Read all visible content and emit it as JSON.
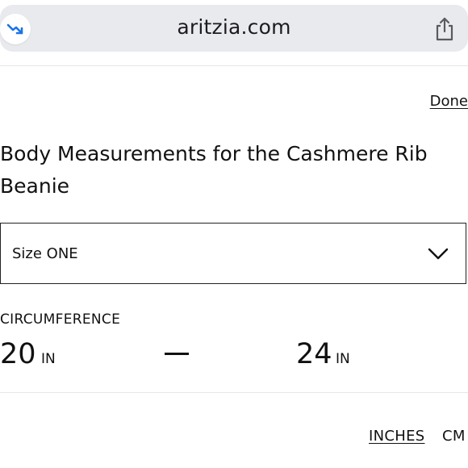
{
  "browser": {
    "url": "aritzia.com"
  },
  "sheet": {
    "done_label": "Done",
    "title": "Body Measurements for the Cashmere Rib Beanie",
    "size_select": {
      "selected": "Size ONE"
    },
    "measurement": {
      "label": "CIRCUMFERENCE",
      "min": "20",
      "max": "24",
      "unit": "IN"
    },
    "unit_toggle": {
      "inches": "INCHES",
      "cm": "CM",
      "active": "INCHES"
    }
  },
  "icons": {
    "left": "trend-arrow-icon",
    "share": "share-icon",
    "select": "chevron-down-icon"
  },
  "colors": {
    "urlbar_bg": "#e9eaee",
    "accent_icon": "#1a73e8",
    "text": "#111111"
  }
}
